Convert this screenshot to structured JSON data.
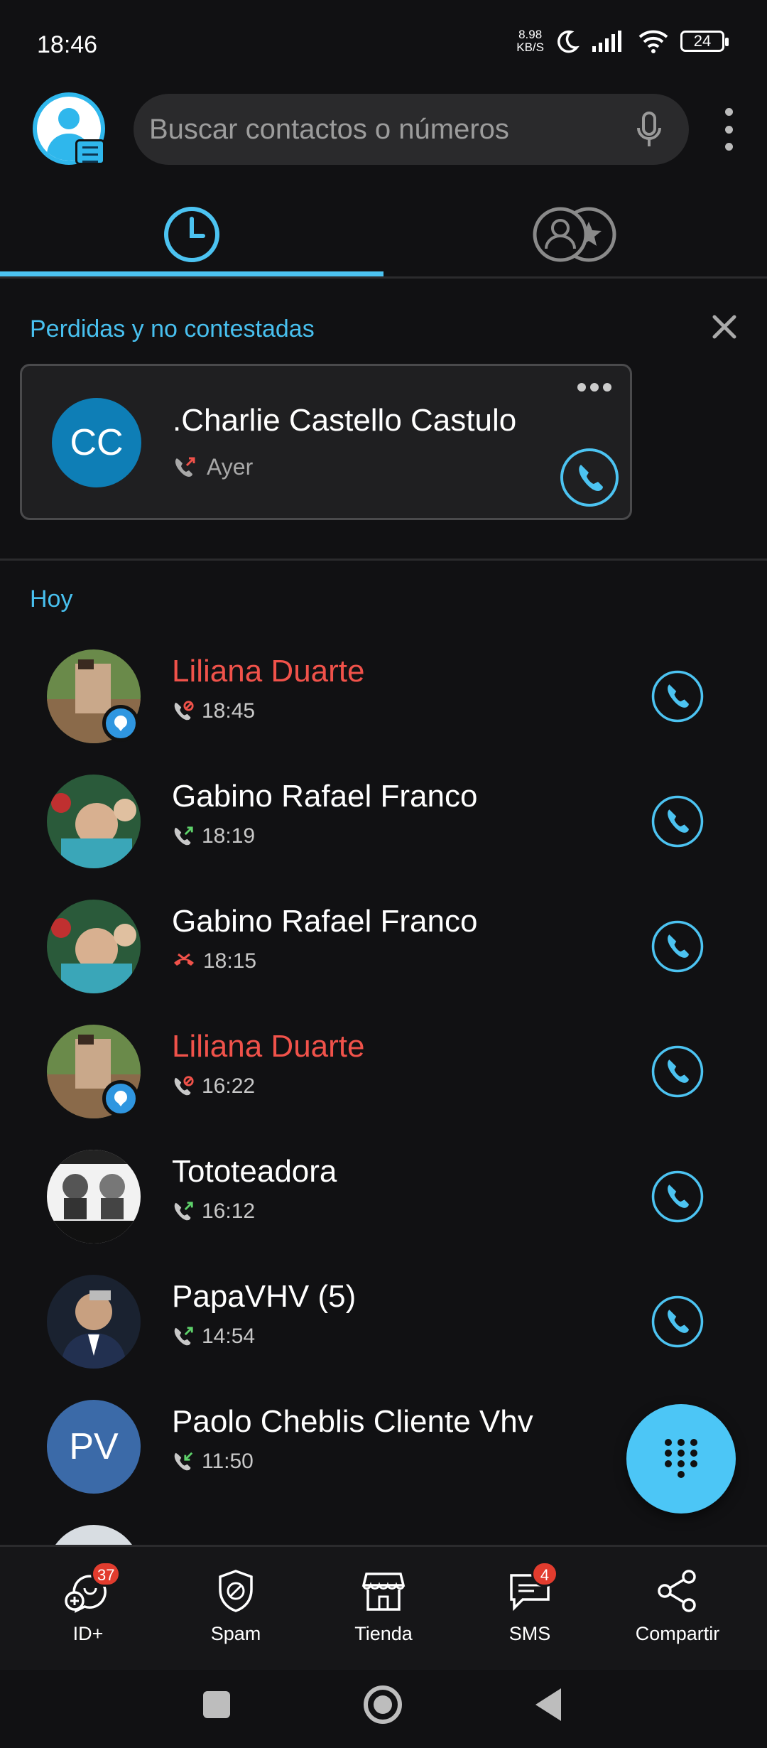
{
  "status_bar": {
    "time": "18:46",
    "speed_value": "8.98",
    "speed_unit": "KB/S",
    "battery": "24"
  },
  "header": {
    "search_placeholder": "Buscar contactos o números"
  },
  "missed_section": {
    "title": "Perdidas y no contestadas",
    "card": {
      "initials": "CC",
      "name": ".Charlie Castello Castulo",
      "when": "Ayer"
    }
  },
  "today_section": {
    "title": "Hoy"
  },
  "calls": [
    {
      "name": "Liliana Duarte",
      "time": "18:45",
      "status": "missed",
      "type": "blocked-icon"
    },
    {
      "name": "Gabino Rafael Franco",
      "time": "18:19",
      "status": "normal",
      "type": "outgoing-icon"
    },
    {
      "name": "Gabino Rafael Franco",
      "time": "18:15",
      "status": "normal",
      "type": "declined-icon"
    },
    {
      "name": "Liliana Duarte",
      "time": "16:22",
      "status": "missed",
      "type": "blocked-icon"
    },
    {
      "name": "Tototeadora",
      "time": "16:12",
      "status": "normal",
      "type": "outgoing-icon"
    },
    {
      "name": "PapaVHV  (5)",
      "time": "14:54",
      "status": "normal",
      "type": "outgoing-icon"
    },
    {
      "name": "Paolo Cheblis Cliente Vhv",
      "time": "11:50",
      "status": "normal",
      "type": "incoming-icon",
      "initials": "PV"
    }
  ],
  "bottom_nav": [
    {
      "label": "ID+",
      "badge": "37"
    },
    {
      "label": "Spam"
    },
    {
      "label": "Tienda"
    },
    {
      "label": "SMS",
      "badge": "4"
    },
    {
      "label": "Compartir"
    }
  ],
  "colors": {
    "accent": "#4cc3f1",
    "missed": "#f0524a",
    "background": "#111113",
    "card": "#1f1f21"
  }
}
